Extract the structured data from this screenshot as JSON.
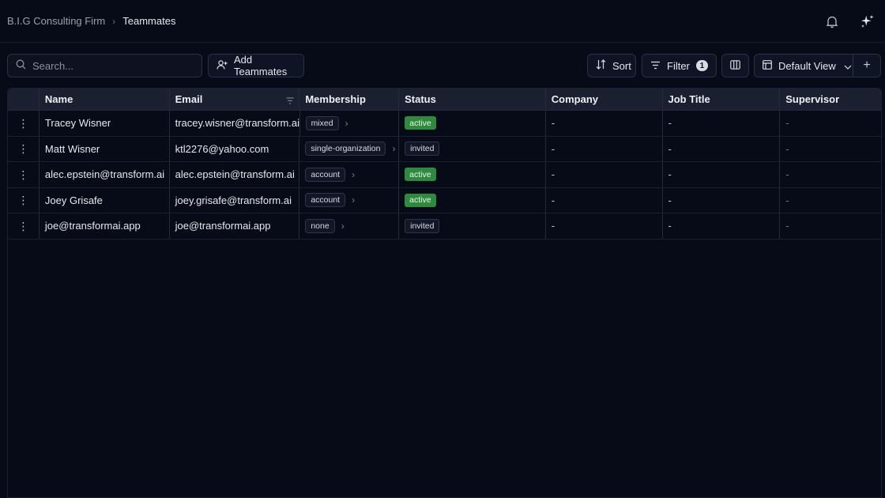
{
  "breadcrumb": {
    "root": "B.I.G Consulting Firm",
    "separator": "›",
    "current": "Teammates"
  },
  "toolbar": {
    "search_placeholder": "Search...",
    "add_label": "Add Teammates",
    "sort_label": "Sort",
    "filter_label": "Filter",
    "filter_count": "1",
    "view_label": "Default View",
    "add_view_label": "+"
  },
  "table": {
    "columns": [
      "Name",
      "Email",
      "Membership",
      "Status",
      "Company",
      "Job Title",
      "Supervisor"
    ],
    "rows": [
      {
        "name": "Tracey Wisner",
        "email": "tracey.wisner@transform.ai",
        "membership": "mixed",
        "status": "active",
        "company": "-",
        "job_title": "-",
        "supervisor": "-"
      },
      {
        "name": "Matt Wisner",
        "email": "ktl2276@yahoo.com",
        "membership": "single-organization",
        "status": "invited",
        "company": "-",
        "job_title": "-",
        "supervisor": "-"
      },
      {
        "name": "alec.epstein@transform.ai",
        "email": "alec.epstein@transform.ai",
        "membership": "account",
        "status": "active",
        "company": "-",
        "job_title": "-",
        "supervisor": "-"
      },
      {
        "name": "Joey Grisafe",
        "email": "joey.grisafe@transform.ai",
        "membership": "account",
        "status": "active",
        "company": "-",
        "job_title": "-",
        "supervisor": "-"
      },
      {
        "name": "joe@transformai.app",
        "email": "joe@transformai.app",
        "membership": "none",
        "status": "invited",
        "company": "-",
        "job_title": "-",
        "supervisor": "-"
      }
    ]
  },
  "colors": {
    "background": "#070b18",
    "active_status": "#2e8b3e",
    "header_bg": "#1b2030"
  },
  "icons": [
    "bell-icon",
    "sparkle-icon",
    "search-icon",
    "add-user-icon",
    "sort-icon",
    "filter-icon",
    "columns-icon",
    "table-view-icon",
    "chevron-down-icon",
    "kebab-icon",
    "chevron-right-icon"
  ]
}
